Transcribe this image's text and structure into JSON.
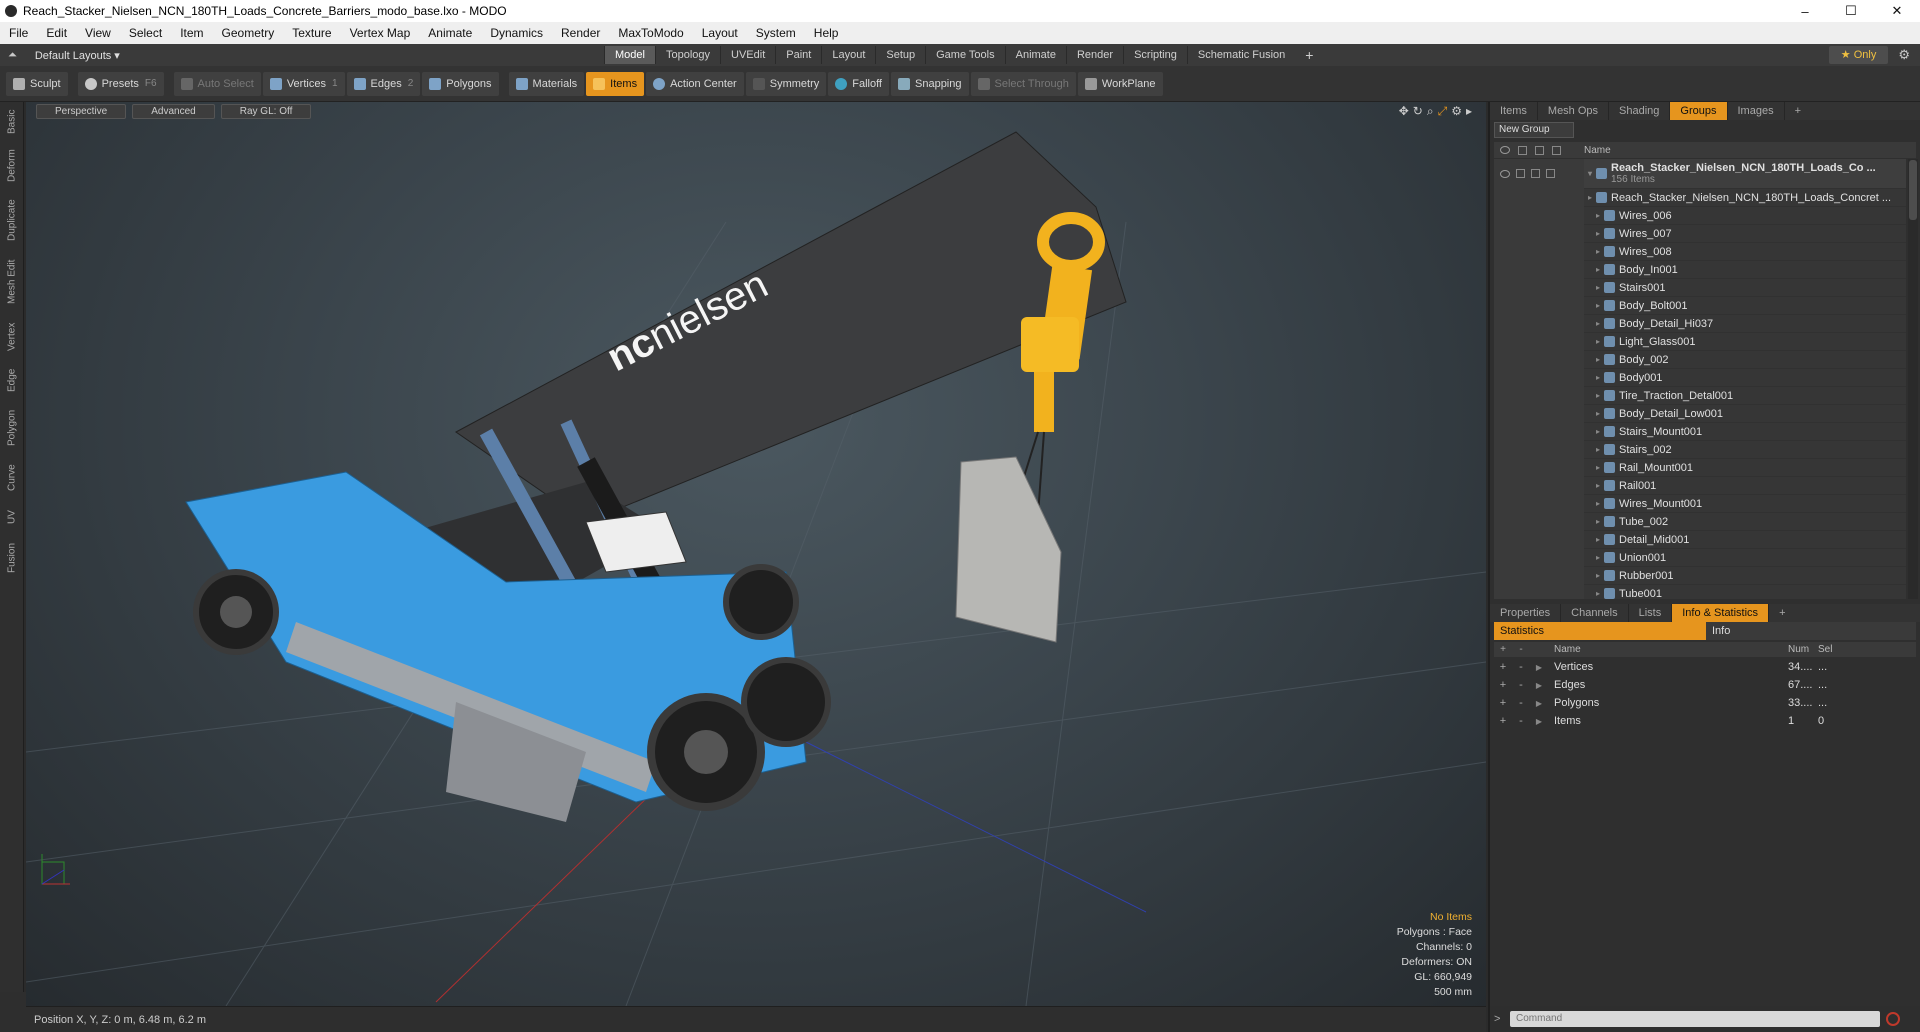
{
  "window": {
    "title": "Reach_Stacker_Nielsen_NCN_180TH_Loads_Concrete_Barriers_modo_base.lxo - MODO",
    "controls": [
      "–",
      "☐",
      "✕"
    ]
  },
  "menu": [
    "File",
    "Edit",
    "View",
    "Select",
    "Item",
    "Geometry",
    "Texture",
    "Vertex Map",
    "Animate",
    "Dynamics",
    "Render",
    "MaxToModo",
    "Layout",
    "System",
    "Help"
  ],
  "layoutbar": {
    "layout_label": "Default Layouts ▾",
    "tabs": [
      "Model",
      "Topology",
      "UVEdit",
      "Paint",
      "Layout",
      "Setup",
      "Game Tools",
      "Animate",
      "Render",
      "Scripting",
      "Schematic Fusion",
      "+"
    ],
    "active_tab": "Model",
    "only_label": "★  Only"
  },
  "toolbar": {
    "sculpt": "Sculpt",
    "presets": "Presets",
    "presets_key": "F6",
    "auto_select": "Auto Select",
    "vertices": "Vertices",
    "vertices_key": "1",
    "edges": "Edges",
    "edges_key": "2",
    "polygons": "Polygons",
    "materials": "Materials",
    "items": "Items",
    "action_center": "Action Center",
    "symmetry": "Symmetry",
    "falloff": "Falloff",
    "snapping": "Snapping",
    "select_through": "Select Through",
    "workplane": "WorkPlane"
  },
  "left_tabs": [
    "Basic",
    "Deform",
    "Duplicate",
    "Mesh Edit",
    "Vertex",
    "Edge",
    "Polygon",
    "Curve",
    "UV",
    "Fusion"
  ],
  "viewport": {
    "view": "Perspective",
    "shading": "Advanced",
    "raygl": "Ray GL: Off",
    "logo_text_bold": "nc",
    "logo_text": "nielsen",
    "info": {
      "items": "No Items",
      "polygons": "Polygons : Face",
      "channels": "Channels: 0",
      "deformers": "Deformers: ON",
      "gl": "GL: 660,949",
      "scale": "500 mm"
    },
    "colors": {
      "body": "#3a9be0",
      "boom": "#3c3d3f",
      "hook": "#f2b21e"
    }
  },
  "status": {
    "position": "Position X, Y, Z:  0 m, 6.48 m, 6.2 m"
  },
  "panel_top": {
    "tabs": [
      "Items",
      "Mesh Ops",
      "Shading",
      "Groups",
      "Images",
      "+"
    ],
    "active": "Groups",
    "new_group": "New Group",
    "name_col": "Name",
    "root": {
      "name": "Reach_Stacker_Nielsen_NCN_180TH_Loads_Co ...",
      "count": "156 Items"
    },
    "items": [
      "Reach_Stacker_Nielsen_NCN_180TH_Loads_Concret ...",
      "Wires_006",
      "Wires_007",
      "Wires_008",
      "Body_In001",
      "Stairs001",
      "Body_Bolt001",
      "Body_Detail_Hi037",
      "Light_Glass001",
      "Body_002",
      "Body001",
      "Tire_Traction_Detal001",
      "Body_Detail_Low001",
      "Stairs_Mount001",
      "Stairs_002",
      "Rail_Mount001",
      "Rail001",
      "Wires_Mount001",
      "Tube_002",
      "Detail_Mid001",
      "Union001",
      "Rubber001",
      "Tube001"
    ]
  },
  "panel_bottom": {
    "tabs": [
      "Properties",
      "Channels",
      "Lists",
      "Info & Statistics",
      "+"
    ],
    "active": "Info & Statistics",
    "stat_tab": "Statistics",
    "info_tab": "Info",
    "head": {
      "name": "Name",
      "num": "Num",
      "sel": "Sel"
    },
    "rows": [
      {
        "name": "Vertices",
        "num": "34....",
        "sel": "..."
      },
      {
        "name": "Edges",
        "num": "67....",
        "sel": "..."
      },
      {
        "name": "Polygons",
        "num": "33....",
        "sel": "..."
      },
      {
        "name": "Items",
        "num": "1",
        "sel": "0"
      }
    ]
  },
  "command": {
    "placeholder": "Command"
  }
}
